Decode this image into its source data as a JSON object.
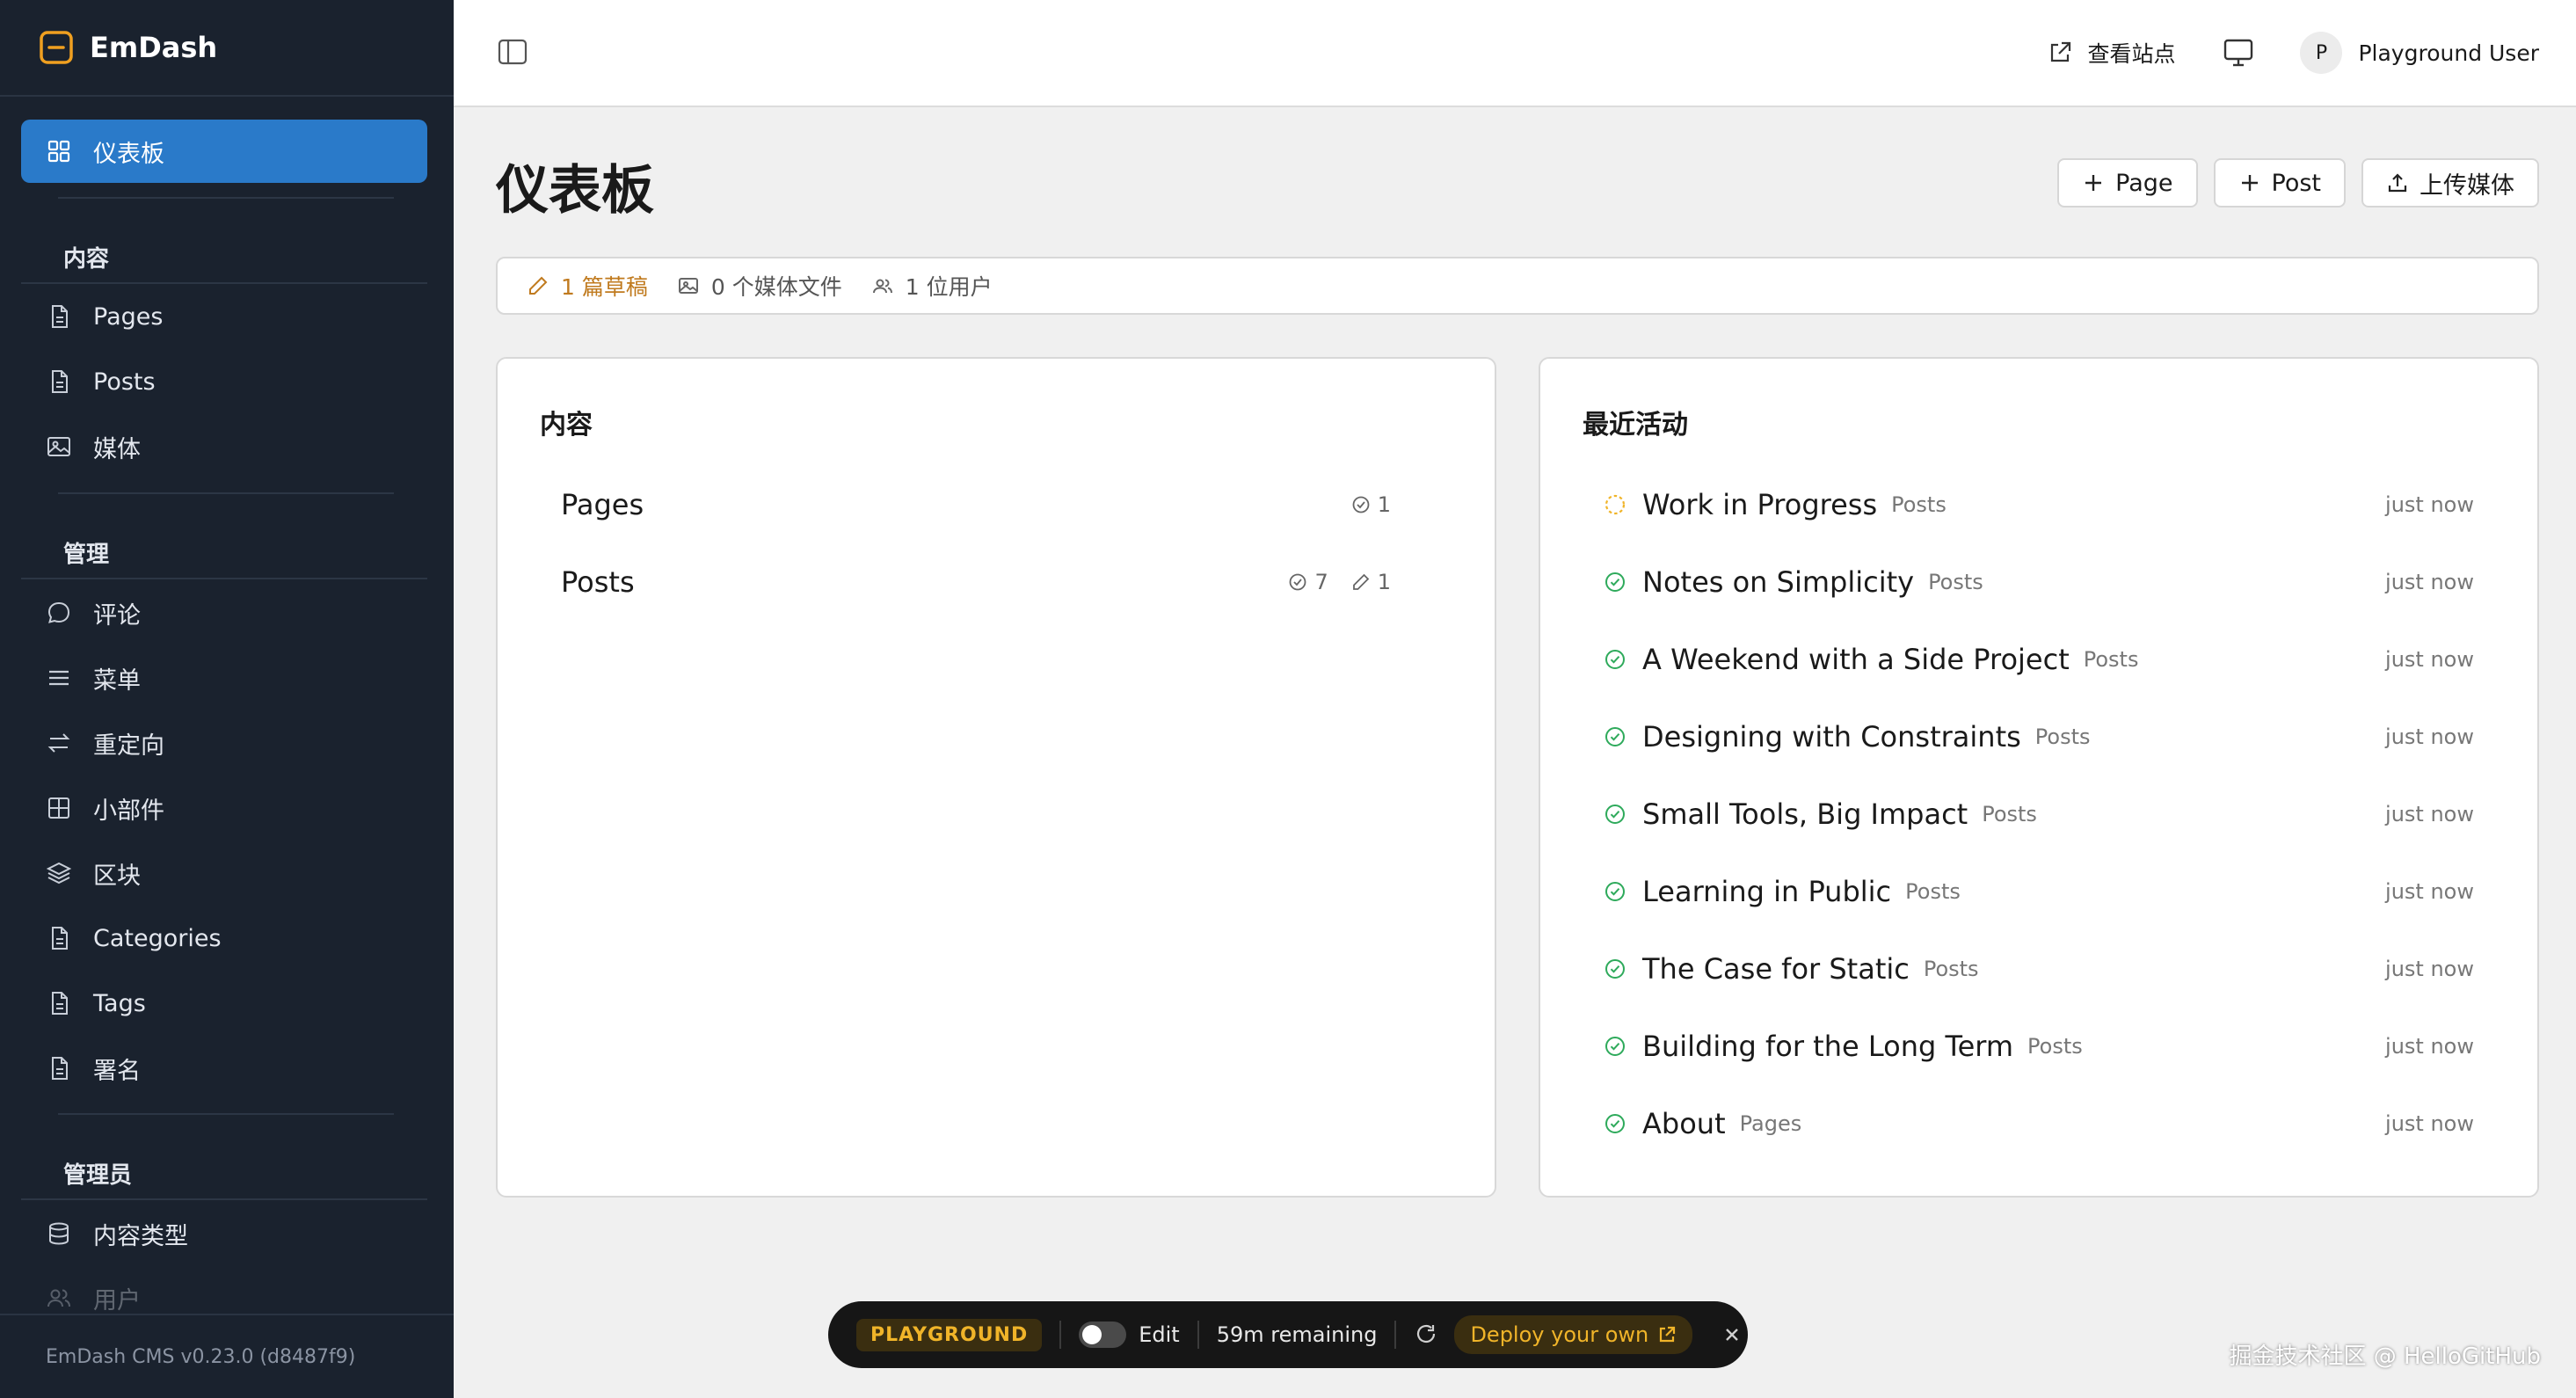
{
  "colors": {
    "sidebar_bg": "#1a222e",
    "active_item": "#2a7ac9",
    "draft_accent": "#c07a1e",
    "success_green": "#2eaa5b",
    "playground_accent": "#f0b429"
  },
  "brand": {
    "name": "EmDash",
    "icon": "emdash-logo-icon"
  },
  "sidebar": {
    "active": {
      "label": "仪表板",
      "icon": "grid-icon"
    },
    "sections": [
      {
        "title": "内容",
        "items": [
          {
            "label": "Pages",
            "icon": "file-icon"
          },
          {
            "label": "Posts",
            "icon": "file-icon"
          },
          {
            "label": "媒体",
            "icon": "image-icon"
          }
        ]
      },
      {
        "title": "管理",
        "items": [
          {
            "label": "评论",
            "icon": "comment-icon"
          },
          {
            "label": "菜单",
            "icon": "menu-icon"
          },
          {
            "label": "重定向",
            "icon": "redirect-icon"
          },
          {
            "label": "小部件",
            "icon": "widget-grid-icon"
          },
          {
            "label": "区块",
            "icon": "layers-icon"
          },
          {
            "label": "Categories",
            "icon": "file-icon"
          },
          {
            "label": "Tags",
            "icon": "file-icon"
          },
          {
            "label": "署名",
            "icon": "file-icon"
          }
        ]
      },
      {
        "title": "管理员",
        "items": [
          {
            "label": "内容类型",
            "icon": "database-icon"
          },
          {
            "label": "用户",
            "icon": "users-icon"
          }
        ]
      }
    ],
    "footer": "EmDash CMS v0.23.0 (d8487f9)"
  },
  "topbar": {
    "view_site": "查看站点",
    "user_initial": "P",
    "user_name": "Playground User"
  },
  "page": {
    "title": "仪表板",
    "actions": {
      "page": "Page",
      "post": "Post",
      "upload": "上传媒体"
    },
    "stats": {
      "drafts": "1 篇草稿",
      "media": "0 个媒体文件",
      "users": "1 位用户"
    }
  },
  "content_card": {
    "title": "内容",
    "rows": [
      {
        "label": "Pages",
        "published": "1",
        "drafts": ""
      },
      {
        "label": "Posts",
        "published": "7",
        "drafts": "1"
      }
    ]
  },
  "activity_card": {
    "title": "最近活动",
    "items": [
      {
        "title": "Work in Progress",
        "collection": "Posts",
        "time": "just now",
        "status": "draft"
      },
      {
        "title": "Notes on Simplicity",
        "collection": "Posts",
        "time": "just now",
        "status": "published"
      },
      {
        "title": "A Weekend with a Side Project",
        "collection": "Posts",
        "time": "just now",
        "status": "published"
      },
      {
        "title": "Designing with Constraints",
        "collection": "Posts",
        "time": "just now",
        "status": "published"
      },
      {
        "title": "Small Tools, Big Impact",
        "collection": "Posts",
        "time": "just now",
        "status": "published"
      },
      {
        "title": "Learning in Public",
        "collection": "Posts",
        "time": "just now",
        "status": "published"
      },
      {
        "title": "The Case for Static",
        "collection": "Posts",
        "time": "just now",
        "status": "published"
      },
      {
        "title": "Building for the Long Term",
        "collection": "Posts",
        "time": "just now",
        "status": "published"
      },
      {
        "title": "About",
        "collection": "Pages",
        "time": "just now",
        "status": "published"
      }
    ]
  },
  "playground_bar": {
    "badge": "PLAYGROUND",
    "edit_label": "Edit",
    "edit_on": false,
    "remaining": "59m remaining",
    "deploy": "Deploy your own"
  },
  "watermark": "掘金技术社区 @ HelloGitHub"
}
